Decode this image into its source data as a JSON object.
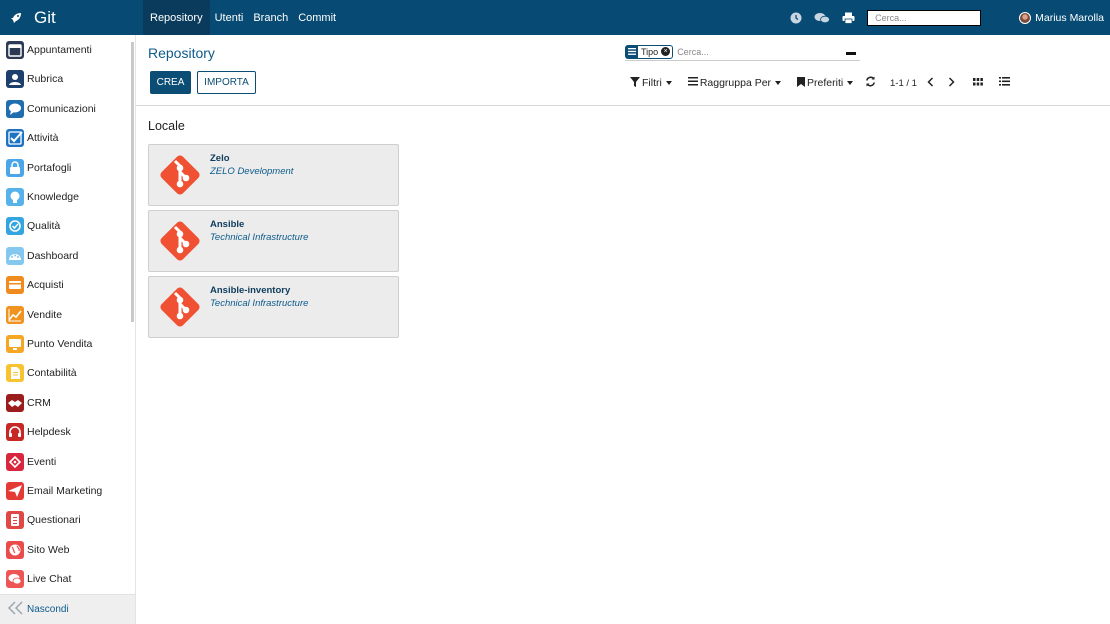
{
  "app": {
    "title": "Git"
  },
  "top_menu": [
    {
      "label": "Repository",
      "active": true
    },
    {
      "label": "Utenti",
      "active": false
    },
    {
      "label": "Branch",
      "active": false
    },
    {
      "label": "Commit",
      "active": false
    }
  ],
  "top_right": {
    "icons": [
      "clock-icon",
      "chat-icon",
      "print-icon"
    ],
    "search_placeholder": "Cerca...",
    "user_name": "Marius Marolla"
  },
  "sidebar": {
    "items": [
      {
        "label": "Appuntamenti",
        "icon": "calendar-icon",
        "color": "#2b3a55"
      },
      {
        "label": "Rubrica",
        "icon": "contacts-icon",
        "color": "#1d3f6e"
      },
      {
        "label": "Comunicazioni",
        "icon": "discuss-icon",
        "color": "#1f6fb0"
      },
      {
        "label": "Attività",
        "icon": "check-icon",
        "color": "#1c73c4"
      },
      {
        "label": "Portafogli",
        "icon": "lock-icon",
        "color": "#4aa6e8"
      },
      {
        "label": "Knowledge",
        "icon": "brain-icon",
        "color": "#56b2ea"
      },
      {
        "label": "Qualità",
        "icon": "quality-icon",
        "color": "#33a5e0"
      },
      {
        "label": "Dashboard",
        "icon": "dashboard-icon",
        "color": "#84c8f0"
      },
      {
        "label": "Acquisti",
        "icon": "card-icon",
        "color": "#f08b1f"
      },
      {
        "label": "Vendite",
        "icon": "chart-icon",
        "color": "#f0931f"
      },
      {
        "label": "Punto Vendita",
        "icon": "monitor-icon",
        "color": "#f5a623"
      },
      {
        "label": "Contabilità",
        "icon": "document-icon",
        "color": "#f7c331"
      },
      {
        "label": "CRM",
        "icon": "handshake-icon",
        "color": "#9b1c1c"
      },
      {
        "label": "Helpdesk",
        "icon": "headset-icon",
        "color": "#c62828"
      },
      {
        "label": "Eventi",
        "icon": "ticket-icon",
        "color": "#d7263d"
      },
      {
        "label": "Email Marketing",
        "icon": "send-icon",
        "color": "#e53935"
      },
      {
        "label": "Questionari",
        "icon": "survey-icon",
        "color": "#e04848"
      },
      {
        "label": "Sito Web",
        "icon": "globe-icon",
        "color": "#ea4c4c"
      },
      {
        "label": "Live Chat",
        "icon": "livechat-icon",
        "color": "#ee5555"
      }
    ],
    "footer_label": "Nascondi"
  },
  "control_panel": {
    "title": "Repository",
    "create_label": "CREA",
    "import_label": "IMPORTA",
    "search": {
      "facet_value": "Tipo",
      "placeholder": "Cerca..."
    },
    "filters_label": "Filtri",
    "group_by_label": "Raggruppa Per",
    "favorites_label": "Preferiti",
    "pager_value": "1-1 / 1"
  },
  "kanban": {
    "group_title": "Locale",
    "cards": [
      {
        "name": "Zelo",
        "subtitle": "ZELO Development"
      },
      {
        "name": "Ansible",
        "subtitle": "Technical Infrastructure"
      },
      {
        "name": "Ansible-inventory",
        "subtitle": "Technical Infrastructure"
      }
    ],
    "logo_color": "#f05133"
  }
}
